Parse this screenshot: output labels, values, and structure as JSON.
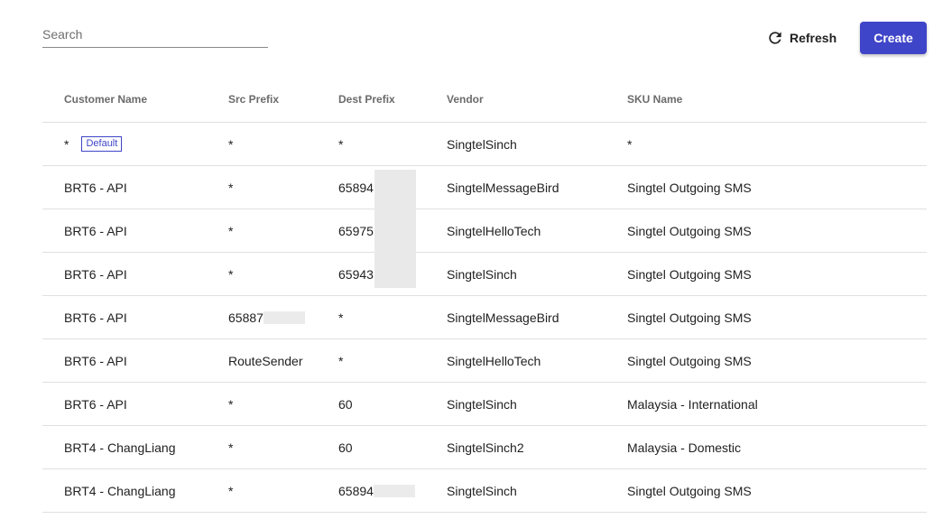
{
  "search": {
    "placeholder": "Search",
    "value": ""
  },
  "toolbar": {
    "refresh_label": "Refresh",
    "create_label": "Create"
  },
  "table": {
    "headers": [
      "Customer Name",
      "Src Prefix",
      "Dest Prefix",
      "Vendor",
      "SKU Name"
    ],
    "default_badge": "Default",
    "rows": [
      {
        "customer": "*",
        "src": "*",
        "dest": "*",
        "vendor": "SingtelSinch",
        "sku": "*"
      },
      {
        "customer": "BRT6 - API",
        "src": "*",
        "dest": "65894",
        "vendor": "SingtelMessageBird",
        "sku": "Singtel Outgoing SMS"
      },
      {
        "customer": "BRT6 - API",
        "src": "*",
        "dest": "65975",
        "vendor": "SingtelHelloTech",
        "sku": "Singtel Outgoing SMS"
      },
      {
        "customer": "BRT6 - API",
        "src": "*",
        "dest": "65943",
        "vendor": "SingtelSinch",
        "sku": "Singtel Outgoing SMS"
      },
      {
        "customer": "BRT6 - API",
        "src": "65887",
        "dest": "*",
        "vendor": "SingtelMessageBird",
        "sku": "Singtel Outgoing SMS"
      },
      {
        "customer": "BRT6 - API",
        "src": "RouteSender",
        "dest": "*",
        "vendor": "SingtelHelloTech",
        "sku": "Singtel Outgoing SMS"
      },
      {
        "customer": "BRT6 - API",
        "src": "*",
        "dest": "60",
        "vendor": "SingtelSinch",
        "sku": "Malaysia - International"
      },
      {
        "customer": "BRT4 - ChangLiang",
        "src": "*",
        "dest": "60",
        "vendor": "SingtelSinch2",
        "sku": "Malaysia - Domestic"
      },
      {
        "customer": "BRT4 - ChangLiang",
        "src": "*",
        "dest": "65894",
        "vendor": "SingtelSinch",
        "sku": "Singtel Outgoing SMS"
      }
    ]
  },
  "icons": {
    "refresh": "refresh-icon"
  },
  "colors": {
    "accent": "#3f45c8",
    "divider": "#e0e0e0",
    "redaction": "#ebebeb"
  }
}
